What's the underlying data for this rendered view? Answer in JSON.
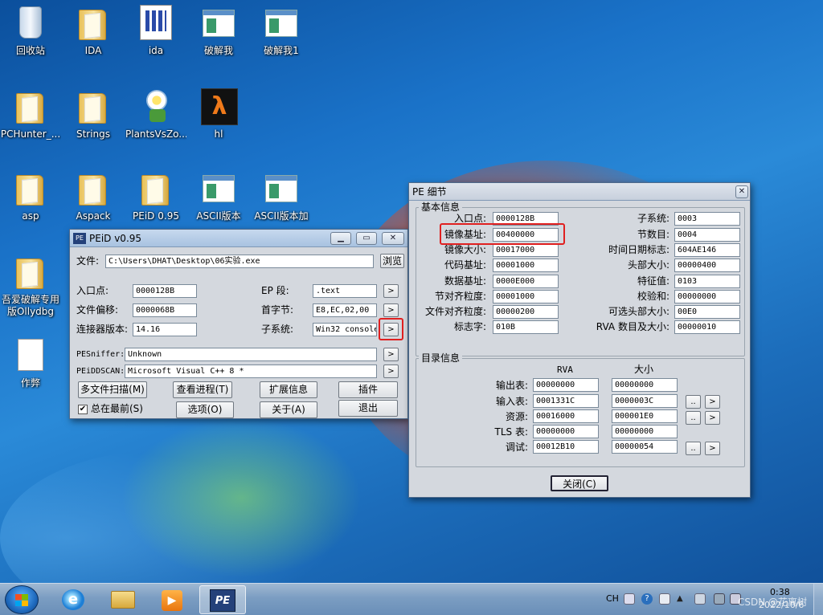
{
  "desktop": {
    "icons": [
      {
        "label": "回收站",
        "icon": "recycle-bin-icon"
      },
      {
        "label": "IDA",
        "icon": "folder-icon"
      },
      {
        "label": "ida",
        "icon": "ida-shortcut-icon"
      },
      {
        "label": "破解我",
        "icon": "window-app-icon"
      },
      {
        "label": "破解我1",
        "icon": "window-app-icon"
      },
      {
        "label": "PCHunter_...",
        "icon": "folder-icon"
      },
      {
        "label": "Strings",
        "icon": "folder-icon"
      },
      {
        "label": "PlantsVsZo...",
        "icon": "plants-app-icon"
      },
      {
        "label": "hl",
        "icon": "half-life-icon"
      },
      {
        "label": "asp",
        "icon": "folder-icon"
      },
      {
        "label": "Aspack",
        "icon": "folder-icon"
      },
      {
        "label": "PEiD 0.95",
        "icon": "folder-icon"
      },
      {
        "label": "ASCII版本",
        "icon": "window-app-icon"
      },
      {
        "label": "ASCII版本加",
        "icon": "window-app-icon"
      },
      {
        "label": "吾爱破解专用版Ollydbg",
        "icon": "folder-icon"
      },
      {
        "label": "作弊",
        "icon": "document-icon"
      }
    ]
  },
  "peid": {
    "title": "PEiD v0.95",
    "file_label": "文件:",
    "file_value": "C:\\Users\\DHAT\\Desktop\\06实验.exe",
    "browse": "浏览",
    "entry_label": "入口点:",
    "entry_value": "0000128B",
    "offset_label": "文件偏移:",
    "offset_value": "0000068B",
    "linker_label": "连接器版本:",
    "linker_value": "14.16",
    "ep_section_label": "EP 段:",
    "ep_section_value": ".text",
    "first_bytes_label": "首字节:",
    "first_bytes_value": "E8,EC,02,00",
    "subsystem_label": "子系统:",
    "subsystem_value": "Win32 console",
    "pesniffer_label": "PESniffer:",
    "pesniffer_value": "Unknown",
    "peiddscan_label": "PEiDDSCAN:",
    "peiddscan_value": "Microsoft Visual C++ 8 *",
    "btn_multi": "多文件扫描(M)",
    "btn_process": "查看进程(T)",
    "btn_ext": "扩展信息",
    "btn_plugins": "插件",
    "ontop_label": "总在最前(S)",
    "ontop_checked": true,
    "btn_options": "选项(O)",
    "btn_about": "关于(A)",
    "btn_exit": "退出",
    "arrow": ">"
  },
  "pe_detail": {
    "title": "PE 细节",
    "basic_group": "基本信息",
    "left_fields": [
      {
        "label": "入口点:",
        "value": "0000128B"
      },
      {
        "label": "镜像基址:",
        "value": "00400000"
      },
      {
        "label": "镜像大小:",
        "value": "00017000"
      },
      {
        "label": "代码基址:",
        "value": "00001000"
      },
      {
        "label": "数据基址:",
        "value": "0000E000"
      },
      {
        "label": "节对齐粒度:",
        "value": "00001000"
      },
      {
        "label": "文件对齐粒度:",
        "value": "00000200"
      },
      {
        "label": "标志字:",
        "value": "010B"
      }
    ],
    "right_fields": [
      {
        "label": "子系统:",
        "value": "0003"
      },
      {
        "label": "节数目:",
        "value": "0004"
      },
      {
        "label": "时间日期标志:",
        "value": "604AE146"
      },
      {
        "label": "头部大小:",
        "value": "00000400"
      },
      {
        "label": "特征值:",
        "value": "0103"
      },
      {
        "label": "校验和:",
        "value": "00000000"
      },
      {
        "label": "可选头部大小:",
        "value": "00E0"
      },
      {
        "label": "RVA 数目及大小:",
        "value": "00000010"
      }
    ],
    "dir_group": "目录信息",
    "col_rva": "RVA",
    "col_size": "大小",
    "dirs": [
      {
        "label": "输出表:",
        "rva": "00000000",
        "size": "00000000"
      },
      {
        "label": "输入表:",
        "rva": "0001331C",
        "size": "0000003C"
      },
      {
        "label": "资源:",
        "rva": "00016000",
        "size": "000001E0"
      },
      {
        "label": "TLS 表:",
        "rva": "00000000",
        "size": "00000000"
      },
      {
        "label": "调试:",
        "rva": "00012B10",
        "size": "00000054"
      }
    ],
    "dots": "..",
    "arrow": ">",
    "close": "关闭(C)"
  },
  "taskbar": {
    "lang": "CH",
    "time": "0:38",
    "date": "2022/10/6",
    "watermark": "CSDN @花离树"
  },
  "colors": {
    "highlight_box": "#e02020",
    "window_bg": "#d4d8de"
  }
}
